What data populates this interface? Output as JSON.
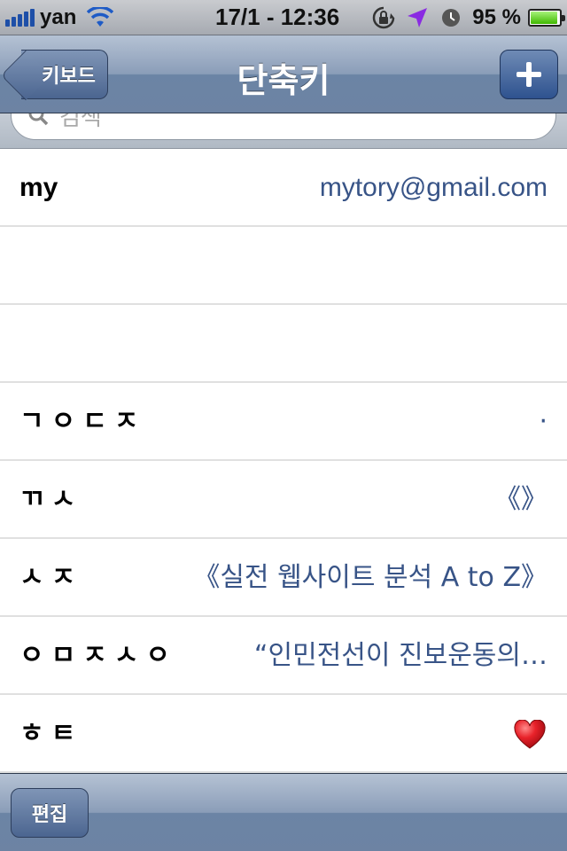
{
  "status_bar": {
    "carrier": "yan",
    "time": "17/1 - 12:36",
    "battery_percent": "95 %",
    "battery_level": 0.95,
    "icons": [
      "signal-bars-icon",
      "wifi-icon",
      "rotation-lock-icon",
      "location-arrow-icon",
      "alarm-clock-icon",
      "battery-icon"
    ]
  },
  "nav": {
    "back_label": "키보드",
    "title": "단축키",
    "add_icon": "plus-icon"
  },
  "search": {
    "placeholder": "검색"
  },
  "shortcuts": [
    {
      "key": "my",
      "phrase": "mytory@gmail.com"
    },
    {
      "key": "",
      "phrase": ""
    },
    {
      "key": "",
      "phrase": ""
    },
    {
      "key": "ㄱㅇㄷㅈ",
      "phrase": "·"
    },
    {
      "key": "ㄲㅅ",
      "phrase": "《》"
    },
    {
      "key": "ㅅㅈ",
      "phrase": "《실전 웹사이트 분석 A to Z》"
    },
    {
      "key": "ㅇㅁㅈㅅㅇ",
      "phrase": "“인민전선이 진보운동의…"
    },
    {
      "key": "ㅎㅌ",
      "phrase": "",
      "icon": "heart-icon"
    }
  ],
  "toolbar": {
    "edit_label": "편집"
  },
  "colors": {
    "nav_blue": "#6d83a3",
    "phrase_blue": "#385487",
    "heart_red": "#d8141b"
  }
}
